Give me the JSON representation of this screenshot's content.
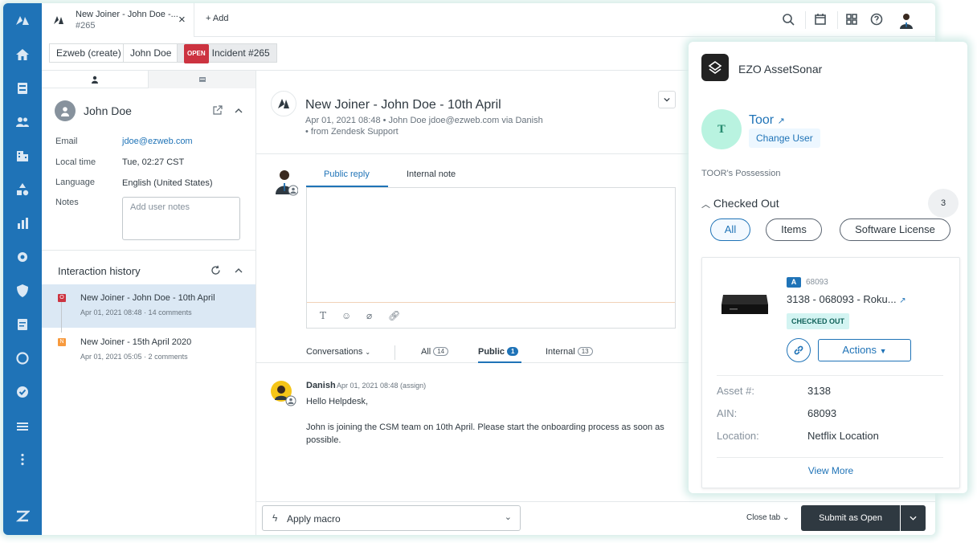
{
  "colors": {
    "brand": "#1f73b7",
    "nav_bg": "#1f73b7",
    "open_badge": "#cc3340",
    "submit_bg": "#2f3941",
    "checked_out_bg": "#d3f4f2"
  },
  "topbar": {
    "tab_title": "New Joiner - John Doe -...",
    "tab_number": "#265",
    "tab_close": "×",
    "add_label": "+ Add",
    "icons": [
      "search-icon",
      "calendar-icon",
      "apps-grid-icon",
      "help-icon",
      "avatar"
    ]
  },
  "nav": {
    "icons": [
      "zendesk-logo",
      "home-icon",
      "views-icon",
      "customers-icon",
      "organizations-icon",
      "shapes-icon",
      "reporting-icon",
      "admin-gear-icon",
      "shield-icon",
      "form-icon",
      "sync-icon",
      "check-circle-icon",
      "list-icon",
      "more-icon",
      "zendesk-z-icon"
    ]
  },
  "breadcrumb": {
    "items": [
      "Ezweb (create)",
      "John Doe"
    ],
    "status_badge": "OPEN",
    "incident": "Incident #265"
  },
  "user": {
    "name": "John Doe",
    "email_label": "Email",
    "email": "jdoe@ezweb.com",
    "localtime_label": "Local time",
    "localtime": "Tue, 02:27 CST",
    "language_label": "Language",
    "language": "English (United States)",
    "notes_label": "Notes",
    "notes_placeholder": "Add user notes"
  },
  "history": {
    "title": "Interaction history",
    "items": [
      {
        "badge": "O",
        "badge_color": "#cc3340",
        "title": "New Joiner - John Doe - 10th April",
        "meta": "Apr 01, 2021 08:48 · 14 comments"
      },
      {
        "badge": "N",
        "badge_color": "#f79a3e",
        "title": "New Joiner - 15th April 2020",
        "meta": "Apr 01, 2021 05:05 · 2 comments"
      }
    ]
  },
  "ticket": {
    "title": "New Joiner - John Doe - 10th April",
    "meta": "Apr 01, 2021 08:48 • John Doe   jdoe@ezweb.com via Danish",
    "meta2": "• from Zendesk Support",
    "reply_tab": "Public reply",
    "note_tab": "Internal note",
    "conversations_label": "Conversations",
    "filter_all": "All",
    "filter_all_count": "14",
    "filter_public": "Public",
    "filter_public_count": "1",
    "filter_internal": "Internal",
    "filter_internal_count": "13",
    "message": {
      "author": "Danish",
      "time": "Apr 01, 2021 08:48 (assign)",
      "line1": "Hello Helpdesk,",
      "line2": "John is joining the CSM team on 10th April. Please start the onboarding process as soon as possible."
    }
  },
  "bottombar": {
    "macro_label": "Apply macro",
    "close_tab": "Close tab",
    "submit_label": "Submit as Open"
  },
  "app": {
    "title": "EZO AssetSonar",
    "user_initial": "T",
    "user_name": "Toor",
    "change_user": "Change User",
    "possession_label": "TOOR's Possession",
    "checked_out_title": "Checked Out",
    "checked_out_count": "3",
    "filters": [
      "All",
      "Items",
      "Software License"
    ],
    "asset": {
      "badge": "A",
      "id": "68093",
      "name": "3138 - 068093 - Roku...",
      "status": "CHECKED OUT",
      "actions_label": "Actions",
      "fields": [
        {
          "label": "Asset #:",
          "value": "3138"
        },
        {
          "label": "AIN:",
          "value": "68093"
        },
        {
          "label": "Location:",
          "value": "Netflix Location"
        }
      ],
      "view_more": "View More"
    }
  }
}
